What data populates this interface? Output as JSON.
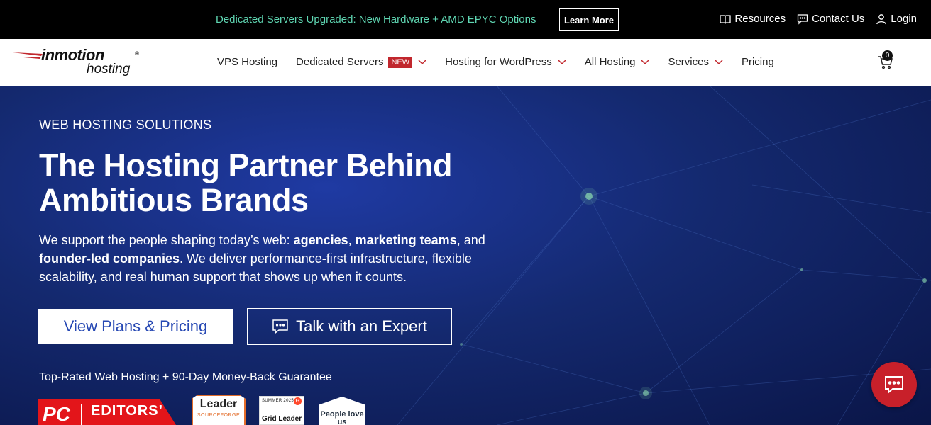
{
  "topbar": {
    "announcement": "Dedicated Servers Upgraded: New Hardware + AMD EPYC Options",
    "learn_more": "Learn More",
    "links": [
      {
        "label": "Resources",
        "icon": "book-icon"
      },
      {
        "label": "Contact Us",
        "icon": "chat-bubble-icon"
      },
      {
        "label": "Login",
        "icon": "user-icon"
      }
    ]
  },
  "brand": {
    "name_line1": "inmotion",
    "name_line2": "hosting",
    "mark": "®"
  },
  "nav": {
    "items": [
      {
        "label": "VPS Hosting"
      },
      {
        "label": "Dedicated Servers",
        "badge": "NEW",
        "dropdown": true
      },
      {
        "label": "Hosting for WordPress",
        "dropdown": true
      },
      {
        "label": "All Hosting",
        "dropdown": true
      },
      {
        "label": "Services",
        "dropdown": true
      },
      {
        "label": "Pricing"
      }
    ],
    "cart_count": "0"
  },
  "hero": {
    "eyebrow": "WEB HOSTING SOLUTIONS",
    "headline": "The Hosting Partner Behind Ambitious Brands",
    "lede_parts": {
      "p1": "We support the people shaping today’s web: ",
      "b1": "agencies",
      "p2": ", ",
      "b2": "marketing teams",
      "p3": ", and ",
      "b3": "founder-led companies",
      "p4": ". We deliver performance-first infrastructure, flexible scalability, and real human support that shows up when it counts."
    },
    "cta_primary": "View Plans & Pricing",
    "cta_secondary": "Talk with an Expert",
    "guarantee": "Top-Rated Web Hosting + 90-Day Money-Back Guarantee"
  },
  "badges": {
    "pc": {
      "logo": "PC",
      "text": "EDITORS’"
    },
    "sourceforge": {
      "title": "Leader",
      "sub": "SOURCEFORGE"
    },
    "g2": {
      "season": "SUMMER 2025",
      "logo": "G",
      "title": "Grid Leader"
    },
    "people": {
      "title": "People love us"
    }
  },
  "colors": {
    "accent_green": "#5fd6b2",
    "brand_red": "#c1272d",
    "cta_blue": "#2547b3",
    "hero_blue": "#14296f"
  }
}
